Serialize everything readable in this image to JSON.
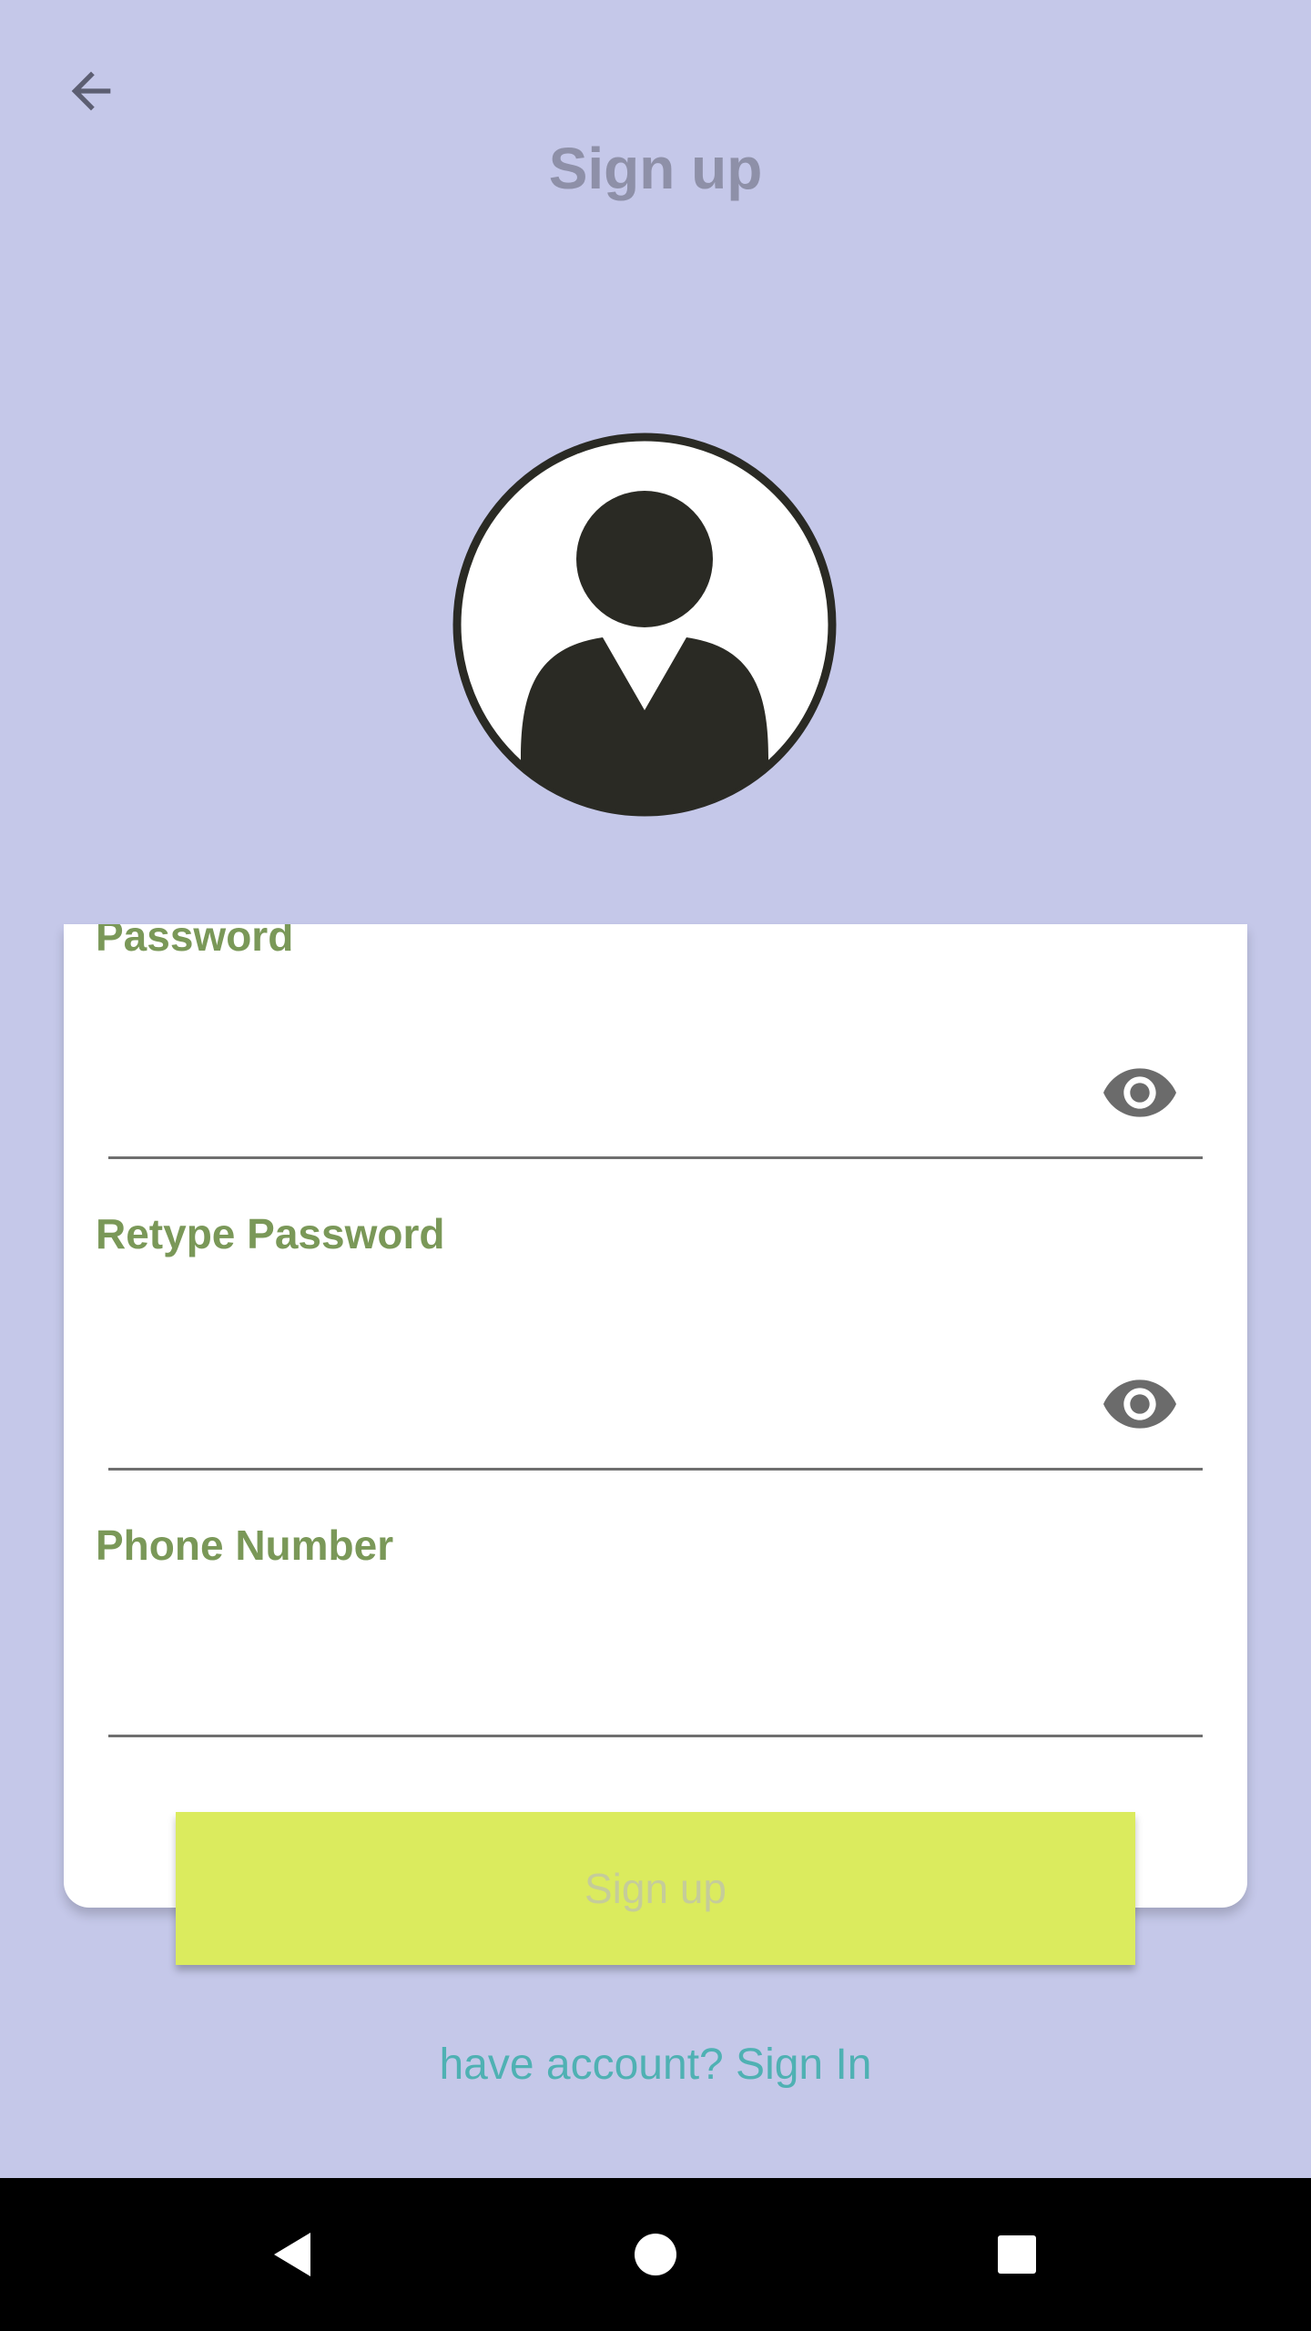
{
  "header": {
    "title": "Sign up",
    "back_icon": "arrow-left-icon"
  },
  "avatar": {
    "icon": "user-avatar-icon"
  },
  "form": {
    "password": {
      "label": "Password",
      "value": "",
      "toggle_icon": "eye-icon"
    },
    "retype_password": {
      "label": "Retype Password",
      "value": "",
      "toggle_icon": "eye-icon"
    },
    "phone_number": {
      "label": "Phone Number",
      "value": ""
    },
    "submit_label": "Sign up"
  },
  "footer": {
    "signin_link": "have account? Sign In"
  },
  "system_nav": {
    "back_icon": "nav-back-icon",
    "home_icon": "nav-home-icon",
    "recents_icon": "nav-recents-icon"
  },
  "colors": {
    "background": "#c5c8e9",
    "label": "#7a9858",
    "button": "#dbeb5e",
    "link": "#4fb1b3",
    "title": "#8e90a8"
  }
}
